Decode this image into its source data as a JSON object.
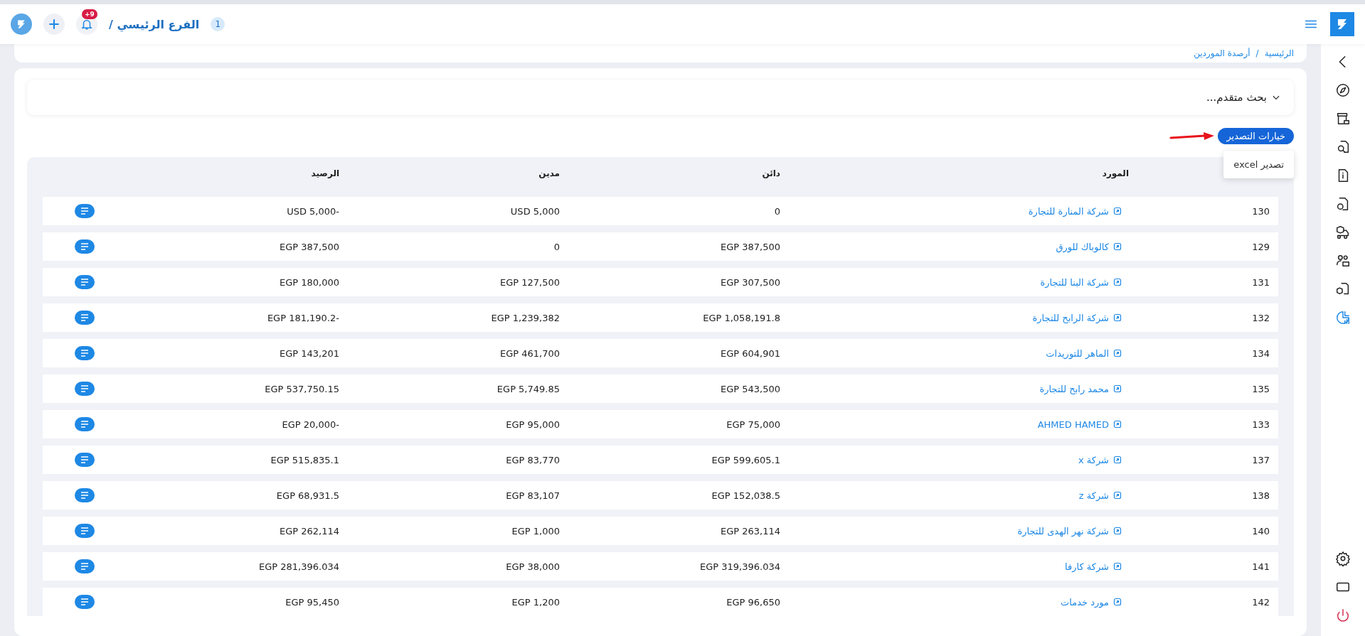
{
  "header": {
    "branch_count": "1",
    "branch": "الفرع الرئيسي /",
    "notification_badge": "+9"
  },
  "breadcrumb": [
    "الرئيسية",
    "/",
    "أرصدة الموردين"
  ],
  "sidebar": {
    "items": [
      {
        "selected": false
      },
      {
        "selected": false
      },
      {
        "selected": false
      },
      {
        "selected": false
      },
      {
        "selected": false
      },
      {
        "selected": false
      },
      {
        "selected": false
      },
      {
        "selected": false
      },
      {
        "selected": false
      },
      {
        "selected": true
      }
    ]
  },
  "advanced_search": {
    "label": "بحث متقدم...",
    "expanded": false
  },
  "export": {
    "button": "خيارات التصدير",
    "menu": [
      "تصدير excel"
    ]
  },
  "table": {
    "columns": [
      "المورد",
      "دائن",
      "مدين",
      "الرصيد"
    ],
    "rows": [
      {
        "number": "130",
        "supplier": "شركة المنارة للتجارة",
        "credit": "0",
        "debit": "USD 5,000",
        "balance": "USD 5,000-"
      },
      {
        "number": "129",
        "supplier": "كالوباك للورق",
        "credit": "EGP 387,500",
        "debit": "0",
        "balance": "EGP 387,500"
      },
      {
        "number": "131",
        "supplier": "شركة البنا للتجارة",
        "credit": "EGP 307,500",
        "debit": "EGP 127,500",
        "balance": "EGP 180,000"
      },
      {
        "number": "132",
        "supplier": "شركة الرابح للتجارة",
        "credit": "EGP 1,058,191.8",
        "debit": "EGP 1,239,382",
        "balance": "EGP 181,190.2-"
      },
      {
        "number": "134",
        "supplier": "الماهر للتوريدات",
        "credit": "EGP 604,901",
        "debit": "EGP 461,700",
        "balance": "EGP 143,201"
      },
      {
        "number": "135",
        "supplier": "محمد رابح للتجارة",
        "credit": "EGP 543,500",
        "debit": "EGP 5,749.85",
        "balance": "EGP 537,750.15"
      },
      {
        "number": "133",
        "supplier": "AHMED HAMED",
        "credit": "EGP 75,000",
        "debit": "EGP 95,000",
        "balance": "EGP 20,000-"
      },
      {
        "number": "137",
        "supplier": "شركة x",
        "credit": "EGP 599,605.1",
        "debit": "EGP 83,770",
        "balance": "EGP 515,835.1"
      },
      {
        "number": "138",
        "supplier": "شركة z",
        "credit": "EGP 152,038.5",
        "debit": "EGP 83,107",
        "balance": "EGP 68,931.5"
      },
      {
        "number": "140",
        "supplier": "شركة  نهر الهدى للتجارة",
        "credit": "EGP 263,114",
        "debit": "EGP 1,000",
        "balance": "EGP 262,114"
      },
      {
        "number": "141",
        "supplier": "شركة كارفا",
        "credit": "EGP 319,396.034",
        "debit": "EGP 38,000",
        "balance": "EGP 281,396.034"
      },
      {
        "number": "142",
        "supplier": "مورد خدمات",
        "credit": "EGP 96,650",
        "debit": "EGP 1,200",
        "balance": "EGP 95,450"
      }
    ]
  }
}
